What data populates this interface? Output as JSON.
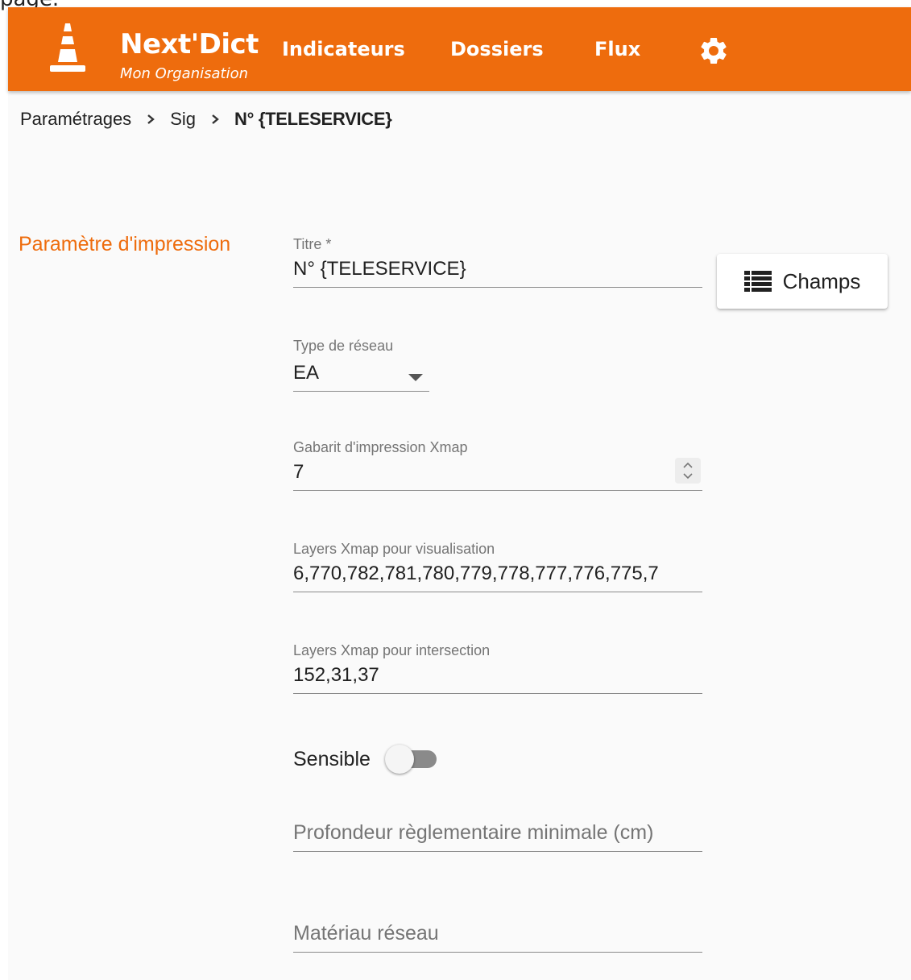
{
  "top_cut_text": "page.",
  "app": {
    "brand": "Next'Dict",
    "organisation": "Mon Organisation",
    "nav": [
      "Indicateurs",
      "Dossiers",
      "Flux"
    ],
    "settings_icon": "gear-icon",
    "accent_color": "#ee6c0d"
  },
  "breadcrumb": {
    "items": [
      "Paramétrages",
      "Sig"
    ],
    "current": "N° {TELESERVICE}"
  },
  "section": {
    "title": "Paramètre d'impression"
  },
  "form": {
    "titre": {
      "label": "Titre *",
      "value": "N° {TELESERVICE}"
    },
    "champs_button": {
      "label": "Champs",
      "icon": "list-icon"
    },
    "type_reseau": {
      "label": "Type de réseau",
      "value": "EA"
    },
    "gabarit": {
      "label": "Gabarit d'impression Xmap",
      "value": "7"
    },
    "layers_visualisation": {
      "label": "Layers Xmap pour visualisation",
      "value": "6,770,782,781,780,779,778,777,776,775,7"
    },
    "layers_intersection": {
      "label": "Layers Xmap pour intersection",
      "value": "152,31,37"
    },
    "sensible": {
      "label": "Sensible",
      "checked": false
    },
    "profondeur": {
      "placeholder": "Profondeur règlementaire minimale (cm)"
    },
    "materiau": {
      "placeholder": "Matériau réseau"
    }
  }
}
